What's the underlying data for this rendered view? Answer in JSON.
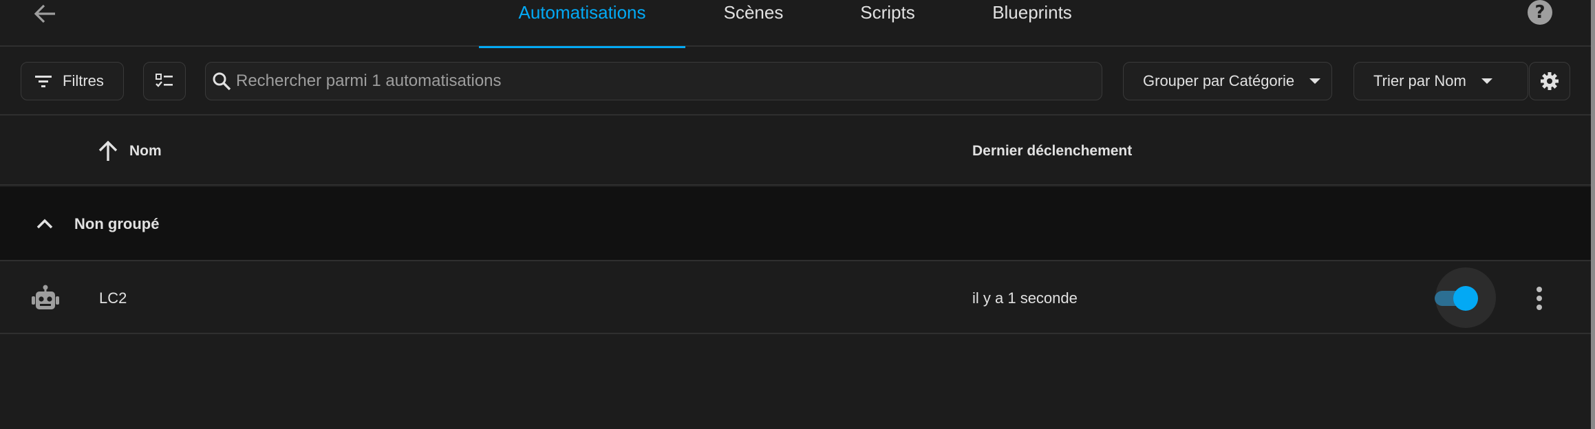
{
  "tabs": [
    {
      "label": "Automatisations",
      "active": true
    },
    {
      "label": "Scènes",
      "active": false
    },
    {
      "label": "Scripts",
      "active": false
    },
    {
      "label": "Blueprints",
      "active": false
    }
  ],
  "help": {
    "label": "?"
  },
  "toolbar": {
    "filters_label": "Filtres",
    "search_placeholder": "Rechercher parmi 1 automatisations",
    "group_label": "Grouper par Catégorie",
    "sort_label": "Trier par Nom"
  },
  "table": {
    "columns": {
      "name": "Nom",
      "last_triggered": "Dernier déclenchement"
    },
    "group": {
      "label": "Non groupé"
    },
    "rows": [
      {
        "name": "LC2",
        "last_triggered": "il y a 1 seconde",
        "enabled": true
      }
    ]
  },
  "colors": {
    "accent": "#03a9f4",
    "background": "#1c1c1c",
    "group_background": "#111111"
  },
  "icons": {
    "back": "arrow-left-icon",
    "help": "help-circle-icon",
    "filter": "filter-icon",
    "selection": "checklist-icon",
    "search": "magnify-icon",
    "settings": "gear-icon",
    "sort": "arrow-up-icon",
    "group_toggle": "chevron-up-icon",
    "row": "robot-icon",
    "overflow": "dots-vertical-icon"
  }
}
